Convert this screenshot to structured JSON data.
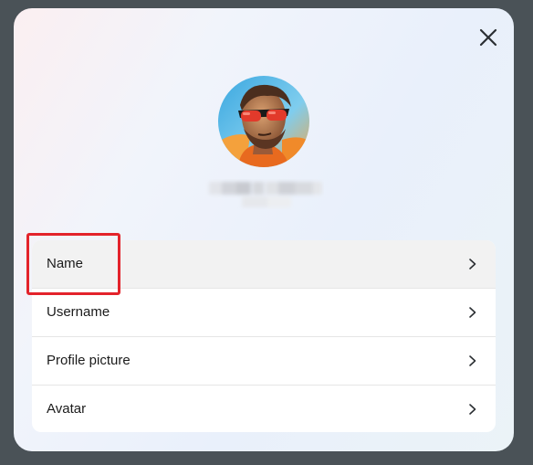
{
  "dialog": {
    "close_icon": "close-icon",
    "avatar_icon": "profile-photo",
    "settings": [
      {
        "label": "Name",
        "icon": "chevron-right-icon",
        "active": true
      },
      {
        "label": "Username",
        "icon": "chevron-right-icon",
        "active": false
      },
      {
        "label": "Profile picture",
        "icon": "chevron-right-icon",
        "active": false
      },
      {
        "label": "Avatar",
        "icon": "chevron-right-icon",
        "active": false
      }
    ]
  },
  "colors": {
    "backdrop": "#4a5257",
    "highlight": "#e3232b",
    "text": "#1b1b1b",
    "active_row": "#f2f2f2"
  }
}
